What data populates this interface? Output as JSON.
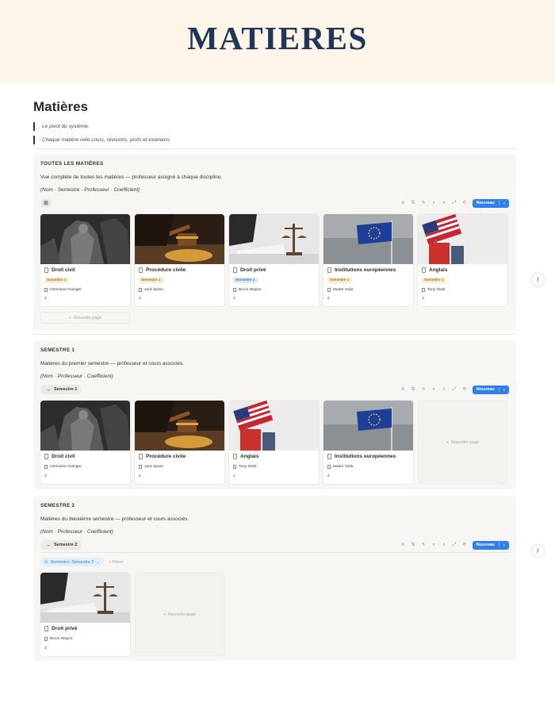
{
  "banner": {
    "title": "MATIERES"
  },
  "page": {
    "title": "Matières",
    "quotes": [
      "Le pivot du système.",
      "Chaque matière relie cours, révisions, profs et examens."
    ]
  },
  "common": {
    "new_button": "Nouveau",
    "new_page": "Nouvelle page",
    "add_filter": "Filtrer"
  },
  "sections": [
    {
      "title": "TOUTES LES MATIÈRES",
      "description": "Vue complète de toutes tes matières — professeur assigné à chaque discipline.",
      "fields": "(Nom · Semestre · Professeur · Coefficient)",
      "view_tab": "",
      "cards": [
        {
          "title": "Droit civil",
          "badge": "Semestre 1",
          "professor": "Hermione Granger",
          "coefficient": "3"
        },
        {
          "title": "Procédure civile",
          "badge": "Semestre 1",
          "professor": "Jack Sparo",
          "coefficient": "2"
        },
        {
          "title": "Droit privé",
          "badge": "Semestre 2",
          "professor": "Bruce Wayne",
          "coefficient": "3"
        },
        {
          "title": "Institutions européennes",
          "badge": "Semestre 1",
          "professor": "Maitre Yoda",
          "coefficient": "2"
        },
        {
          "title": "Anglais",
          "badge": "Semestre 1",
          "professor": "Tony Stark",
          "coefficient": "1"
        }
      ]
    },
    {
      "title": "SEMESTRE 1",
      "description": "Matières du premier semestre — professeur et cours associés.",
      "fields": "(Nom · Professeur · Coefficient)",
      "view_tab": "Semestre 1",
      "cards": [
        {
          "title": "Droit civil",
          "professor": "Hermione Granger",
          "coefficient": "3"
        },
        {
          "title": "Procédure civile",
          "professor": "Jack Sparo",
          "coefficient": "2"
        },
        {
          "title": "Anglais",
          "professor": "Tony Stark",
          "coefficient": "1"
        },
        {
          "title": "Institutions européennes",
          "professor": "Maitre Yoda",
          "coefficient": "2"
        }
      ]
    },
    {
      "title": "SEMESTRE 2",
      "description": "Matières du deuxième semestre — professeur et cours associés.",
      "fields": "(Nom · Professeur · Coefficient)",
      "view_tab": "Semestre 2",
      "filter": "Semestre: Semestre 2",
      "cards": [
        {
          "title": "Droit privé",
          "professor": "Bruce Wayne",
          "coefficient": "3"
        }
      ]
    }
  ],
  "colors": {
    "banner_bg": "#fdf5e8",
    "banner_text": "#1f3559",
    "accent": "#2f80ed",
    "section_bg": "#f7f6f3"
  }
}
